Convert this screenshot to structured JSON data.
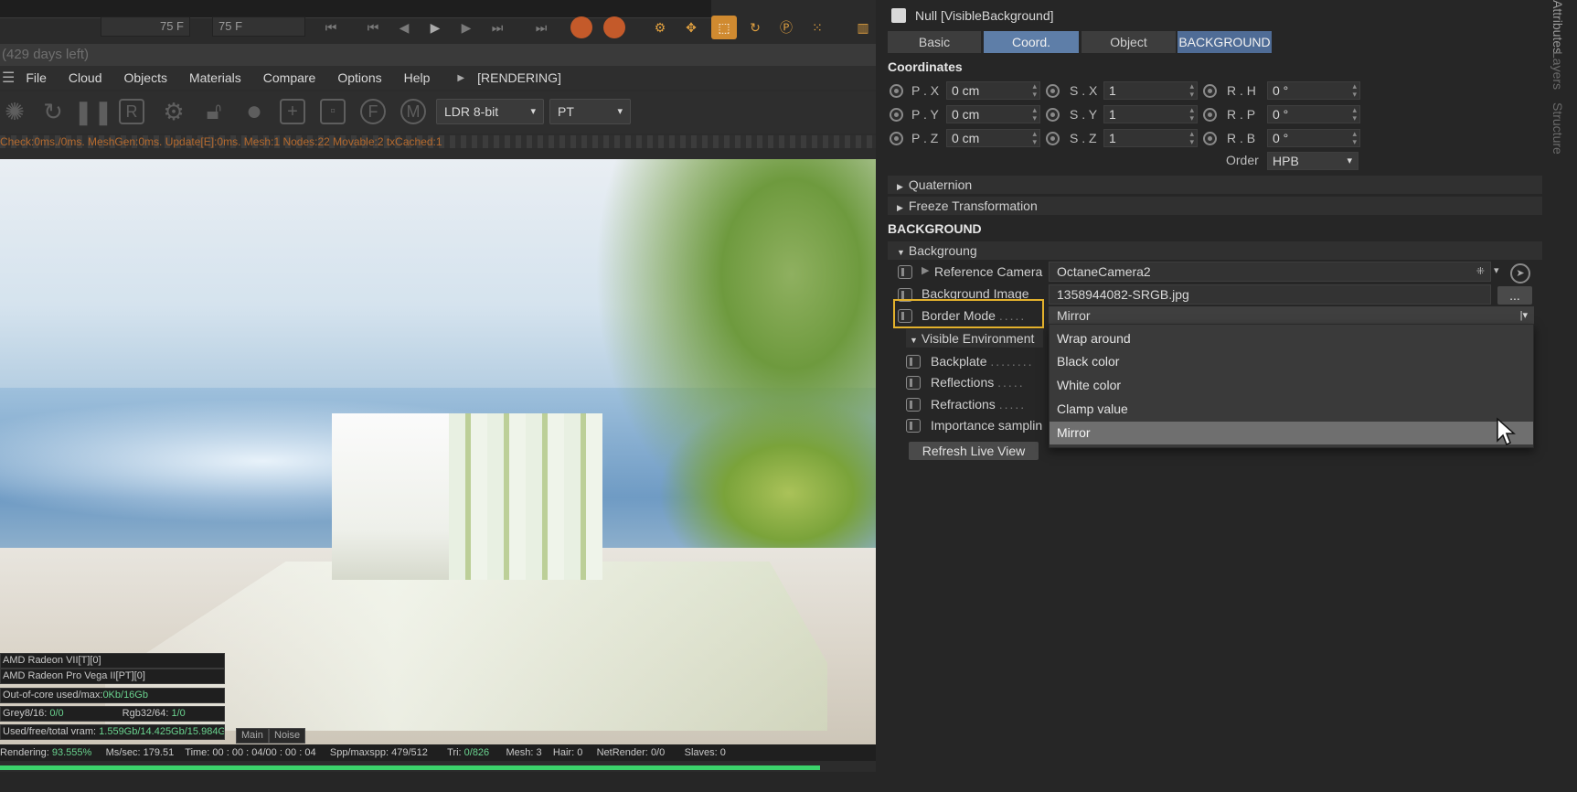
{
  "timeline": {
    "frame_start": "75 F",
    "frame_end": "75 F"
  },
  "viewer": {
    "trial": "(429 days left)",
    "menu": [
      "File",
      "Cloud",
      "Objects",
      "Materials",
      "Compare",
      "Options",
      "Help"
    ],
    "rendering_state": "[RENDERING]",
    "color_depth": "LDR 8-bit",
    "kernel": "PT",
    "status_line": "Check:0ms./0ms. MeshGen:0ms. Update[E]:0ms. Mesh:1 Nodes:22 Movable:2 txCached:1",
    "gpu_lines": [
      {
        "label": "AMD Radeon VII[T][0]",
        "value": ""
      },
      {
        "label": "AMD Radeon Pro Vega II[PT][0]",
        "value": ""
      },
      {
        "label": "Out-of-core used/max:",
        "value": "0Kb/16Gb"
      }
    ],
    "grey_label": "Grey8/16:",
    "grey_value": "0/0",
    "rgb_label": "Rgb32/64:",
    "rgb_value": "1/0",
    "vram_label": "Used/free/total vram:",
    "vram_value": "1.559Gb/14.425Gb/15.984Gb",
    "tab_main": "Main",
    "tab_noise": "Noise",
    "stats": {
      "rendering_label": "Rendering:",
      "rendering_value": "93.555%",
      "ms_label": "Ms/sec:",
      "ms_value": "179.51",
      "time_label": "Time:",
      "time_value": "00 : 00 : 04/00 : 00 : 04",
      "spp_label": "Spp/maxspp:",
      "spp_value": "479/512",
      "tri_label": "Tri:",
      "tri_value": "0/826",
      "mesh_label": "Mesh:",
      "mesh_value": "3",
      "hair_label": "Hair:",
      "hair_value": "0",
      "net_label": "NetRender:",
      "net_value": "0/0",
      "slaves_label": "Slaves:",
      "slaves_value": "0"
    },
    "progress": 0.936
  },
  "attributes": {
    "title": "Null [VisibleBackground]",
    "tabs": [
      "Basic",
      "Coord.",
      "Object",
      "BACKGROUND"
    ],
    "coordinates_heading": "Coordinates",
    "coords": [
      {
        "p_label": "P . X",
        "p_value": "0 cm",
        "s_label": "S . X",
        "s_value": "1",
        "r_label": "R . H",
        "r_value": "0 °"
      },
      {
        "p_label": "P . Y",
        "p_value": "0 cm",
        "s_label": "S . Y",
        "s_value": "1",
        "r_label": "R . P",
        "r_value": "0 °"
      },
      {
        "p_label": "P . Z",
        "p_value": "0 cm",
        "s_label": "S . Z",
        "s_value": "1",
        "r_label": "R . B",
        "r_value": "0 °"
      }
    ],
    "order_label": "Order",
    "order_value": "HPB",
    "quaternion": "Quaternion",
    "freeze": "Freeze Transformation",
    "background_heading": "BACKGROUND",
    "backgroung_group": "Backgroung",
    "reference_camera_label": "Reference Camera",
    "reference_camera_value": "OctaneCamera2",
    "background_image_label": "Background Image",
    "background_image_value": "1358944082-SRGB.jpg",
    "background_image_button": "...",
    "border_mode_label": "Border Mode",
    "border_mode_value": "Mirror",
    "border_mode_options": [
      "Wrap around",
      "Black color",
      "White color",
      "Clamp value",
      "Mirror"
    ],
    "visible_env_group": "Visible Environment",
    "backplate_label": "Backplate",
    "reflections_label": "Reflections",
    "refractions_label": "Refractions",
    "importance_label": "Importance samplin",
    "refresh_button": "Refresh Live View"
  },
  "side_tabs": [
    "Attributes",
    "Layers",
    "Structure"
  ],
  "colors": {
    "accent": "#5e7ea8",
    "highlight_box": "#e3b12c",
    "progress": "#3bd26b"
  }
}
